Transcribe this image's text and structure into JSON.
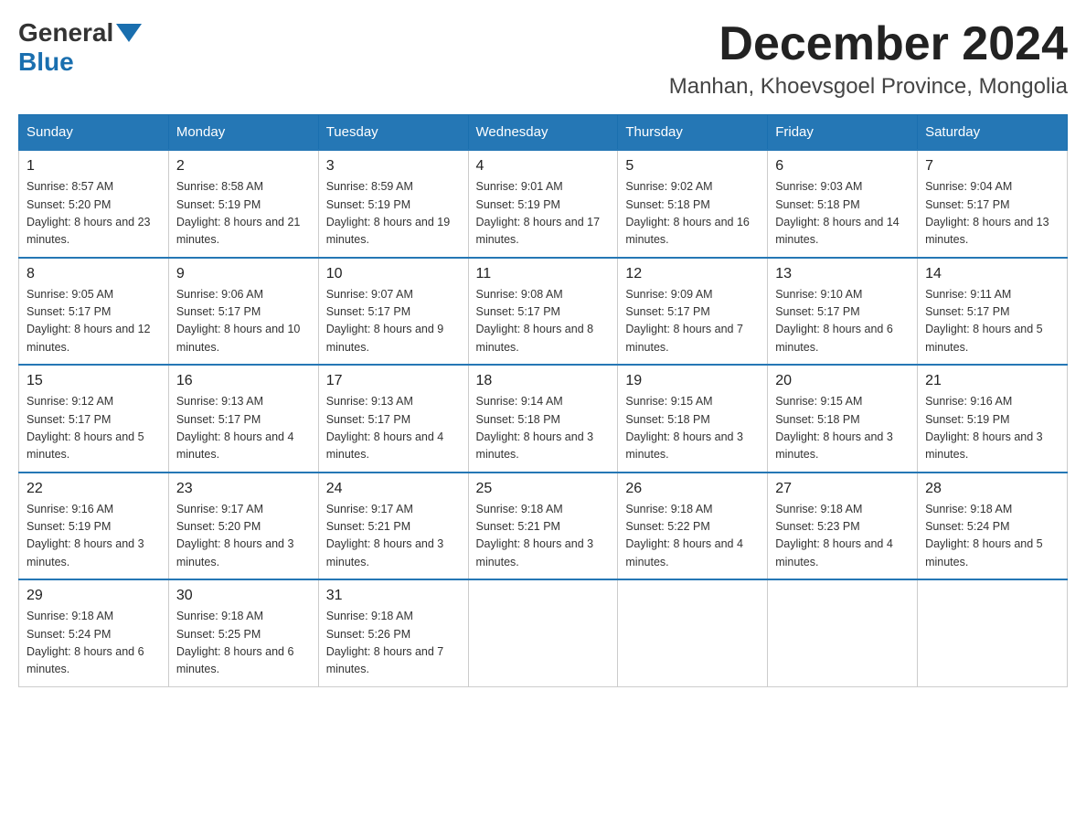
{
  "logo": {
    "general": "General",
    "blue": "Blue"
  },
  "header": {
    "month_title": "December 2024",
    "location": "Manhan, Khoevsgoel Province, Mongolia"
  },
  "days_of_week": [
    "Sunday",
    "Monday",
    "Tuesday",
    "Wednesday",
    "Thursday",
    "Friday",
    "Saturday"
  ],
  "weeks": [
    [
      {
        "day": "1",
        "sunrise": "8:57 AM",
        "sunset": "5:20 PM",
        "daylight": "8 hours and 23 minutes."
      },
      {
        "day": "2",
        "sunrise": "8:58 AM",
        "sunset": "5:19 PM",
        "daylight": "8 hours and 21 minutes."
      },
      {
        "day": "3",
        "sunrise": "8:59 AM",
        "sunset": "5:19 PM",
        "daylight": "8 hours and 19 minutes."
      },
      {
        "day": "4",
        "sunrise": "9:01 AM",
        "sunset": "5:19 PM",
        "daylight": "8 hours and 17 minutes."
      },
      {
        "day": "5",
        "sunrise": "9:02 AM",
        "sunset": "5:18 PM",
        "daylight": "8 hours and 16 minutes."
      },
      {
        "day": "6",
        "sunrise": "9:03 AM",
        "sunset": "5:18 PM",
        "daylight": "8 hours and 14 minutes."
      },
      {
        "day": "7",
        "sunrise": "9:04 AM",
        "sunset": "5:17 PM",
        "daylight": "8 hours and 13 minutes."
      }
    ],
    [
      {
        "day": "8",
        "sunrise": "9:05 AM",
        "sunset": "5:17 PM",
        "daylight": "8 hours and 12 minutes."
      },
      {
        "day": "9",
        "sunrise": "9:06 AM",
        "sunset": "5:17 PM",
        "daylight": "8 hours and 10 minutes."
      },
      {
        "day": "10",
        "sunrise": "9:07 AM",
        "sunset": "5:17 PM",
        "daylight": "8 hours and 9 minutes."
      },
      {
        "day": "11",
        "sunrise": "9:08 AM",
        "sunset": "5:17 PM",
        "daylight": "8 hours and 8 minutes."
      },
      {
        "day": "12",
        "sunrise": "9:09 AM",
        "sunset": "5:17 PM",
        "daylight": "8 hours and 7 minutes."
      },
      {
        "day": "13",
        "sunrise": "9:10 AM",
        "sunset": "5:17 PM",
        "daylight": "8 hours and 6 minutes."
      },
      {
        "day": "14",
        "sunrise": "9:11 AM",
        "sunset": "5:17 PM",
        "daylight": "8 hours and 5 minutes."
      }
    ],
    [
      {
        "day": "15",
        "sunrise": "9:12 AM",
        "sunset": "5:17 PM",
        "daylight": "8 hours and 5 minutes."
      },
      {
        "day": "16",
        "sunrise": "9:13 AM",
        "sunset": "5:17 PM",
        "daylight": "8 hours and 4 minutes."
      },
      {
        "day": "17",
        "sunrise": "9:13 AM",
        "sunset": "5:17 PM",
        "daylight": "8 hours and 4 minutes."
      },
      {
        "day": "18",
        "sunrise": "9:14 AM",
        "sunset": "5:18 PM",
        "daylight": "8 hours and 3 minutes."
      },
      {
        "day": "19",
        "sunrise": "9:15 AM",
        "sunset": "5:18 PM",
        "daylight": "8 hours and 3 minutes."
      },
      {
        "day": "20",
        "sunrise": "9:15 AM",
        "sunset": "5:18 PM",
        "daylight": "8 hours and 3 minutes."
      },
      {
        "day": "21",
        "sunrise": "9:16 AM",
        "sunset": "5:19 PM",
        "daylight": "8 hours and 3 minutes."
      }
    ],
    [
      {
        "day": "22",
        "sunrise": "9:16 AM",
        "sunset": "5:19 PM",
        "daylight": "8 hours and 3 minutes."
      },
      {
        "day": "23",
        "sunrise": "9:17 AM",
        "sunset": "5:20 PM",
        "daylight": "8 hours and 3 minutes."
      },
      {
        "day": "24",
        "sunrise": "9:17 AM",
        "sunset": "5:21 PM",
        "daylight": "8 hours and 3 minutes."
      },
      {
        "day": "25",
        "sunrise": "9:18 AM",
        "sunset": "5:21 PM",
        "daylight": "8 hours and 3 minutes."
      },
      {
        "day": "26",
        "sunrise": "9:18 AM",
        "sunset": "5:22 PM",
        "daylight": "8 hours and 4 minutes."
      },
      {
        "day": "27",
        "sunrise": "9:18 AM",
        "sunset": "5:23 PM",
        "daylight": "8 hours and 4 minutes."
      },
      {
        "day": "28",
        "sunrise": "9:18 AM",
        "sunset": "5:24 PM",
        "daylight": "8 hours and 5 minutes."
      }
    ],
    [
      {
        "day": "29",
        "sunrise": "9:18 AM",
        "sunset": "5:24 PM",
        "daylight": "8 hours and 6 minutes."
      },
      {
        "day": "30",
        "sunrise": "9:18 AM",
        "sunset": "5:25 PM",
        "daylight": "8 hours and 6 minutes."
      },
      {
        "day": "31",
        "sunrise": "9:18 AM",
        "sunset": "5:26 PM",
        "daylight": "8 hours and 7 minutes."
      },
      null,
      null,
      null,
      null
    ]
  ]
}
